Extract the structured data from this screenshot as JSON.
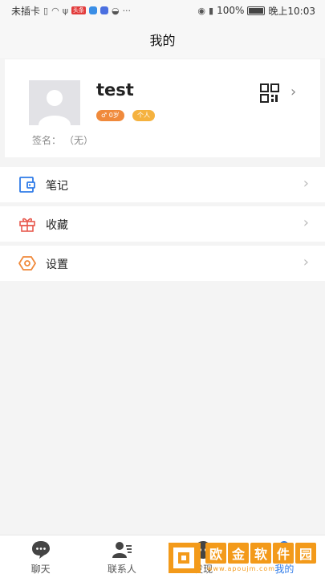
{
  "status_bar": {
    "carrier": "未插卡",
    "battery_level": "100%",
    "time": "晚上10:03",
    "badge": "头条"
  },
  "header": {
    "title": "我的"
  },
  "profile": {
    "username": "test",
    "age_tag": "♂ 0岁",
    "type_tag": "个人",
    "signature_label": "签名：",
    "signature_value": "（无）"
  },
  "menu": {
    "items": [
      {
        "label": "笔记",
        "icon": "notebook-icon"
      },
      {
        "label": "收藏",
        "icon": "gift-icon"
      },
      {
        "label": "设置",
        "icon": "settings-icon"
      }
    ]
  },
  "bottom_nav": {
    "items": [
      {
        "label": "聊天",
        "icon": "chat-bubble-icon"
      },
      {
        "label": "联系人",
        "icon": "contacts-icon"
      },
      {
        "label": "发现",
        "icon": "discover-icon"
      },
      {
        "label": "我的",
        "icon": "me-icon"
      }
    ],
    "active_index": 3
  },
  "watermark": {
    "chars": [
      "欧",
      "金",
      "软",
      "件",
      "园"
    ],
    "url": "www.apoujm.com"
  },
  "colors": {
    "accent_blue": "#2f7be8",
    "age_tag": "#f08a3c",
    "type_tag": "#f5b23f",
    "notebook_icon": "#2f7be8",
    "gift_icon": "#e85a4f",
    "settings_icon": "#f08a3c"
  }
}
